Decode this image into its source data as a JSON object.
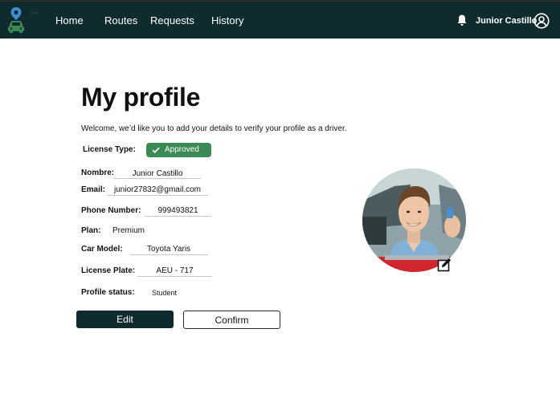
{
  "nav": {
    "items": [
      {
        "label": "Home"
      },
      {
        "label": "Routes"
      },
      {
        "label": "Requests"
      },
      {
        "label": "History"
      }
    ],
    "user_name": "Junior Castillo",
    "icons": {
      "logo": "car-pin-logo-icon",
      "notifications": "bell-icon",
      "account": "user-circle-icon"
    }
  },
  "page": {
    "title": "My profile",
    "intro": "Welcome, we’d like you to add your details to verify your profile as a driver."
  },
  "license": {
    "label": "License Type:",
    "status": "Approved",
    "status_color": "#3b8a55",
    "status_icon": "check-icon"
  },
  "fields": {
    "nombre": {
      "label": "Nombre:",
      "value": "Junior Castillo"
    },
    "email": {
      "label": "Email:",
      "value": "junior27832@gmail.com"
    },
    "phone": {
      "label": "Phone Number:",
      "value": "999493821"
    },
    "plan": {
      "label": "Plan:",
      "value": "Premium"
    },
    "car_model": {
      "label": "Car Model:",
      "value": "Toyota Yaris"
    },
    "license_plate": {
      "label": "License Plate:",
      "value": "AEU - 717"
    },
    "profile_status": {
      "label": "Profile status:",
      "value": "Student"
    }
  },
  "actions": {
    "edit_label": "Edit",
    "confirm_label": "Confirm"
  },
  "avatar": {
    "edit_icon": "edit-pencil-icon"
  },
  "colors": {
    "navbar": "#0f2b2d",
    "primary_button": "#0f2b2d",
    "approved": "#3b8a55"
  }
}
